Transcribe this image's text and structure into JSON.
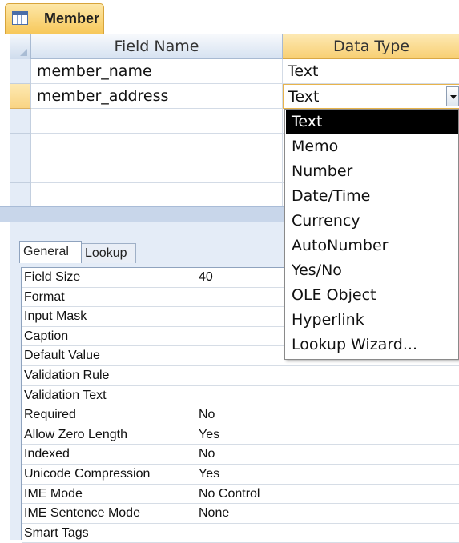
{
  "tab": {
    "title": "Member",
    "icon": "table-icon"
  },
  "grid": {
    "headers": {
      "field_name": "Field Name",
      "data_type": "Data Type"
    },
    "rows": [
      {
        "field": "member_name",
        "type": "Text"
      },
      {
        "field": "member_address",
        "type": "Text"
      }
    ]
  },
  "dropdown": {
    "selected": "Text",
    "options": [
      "Text",
      "Memo",
      "Number",
      "Date/Time",
      "Currency",
      "AutoNumber",
      "Yes/No",
      "OLE Object",
      "Hyperlink",
      "Lookup Wizard..."
    ]
  },
  "properties": {
    "tabs": {
      "general": "General",
      "lookup": "Lookup"
    },
    "rows": [
      {
        "name": "Field Size",
        "value": "40"
      },
      {
        "name": "Format",
        "value": ""
      },
      {
        "name": "Input Mask",
        "value": ""
      },
      {
        "name": "Caption",
        "value": ""
      },
      {
        "name": "Default Value",
        "value": ""
      },
      {
        "name": "Validation Rule",
        "value": ""
      },
      {
        "name": "Validation Text",
        "value": ""
      },
      {
        "name": "Required",
        "value": "No"
      },
      {
        "name": "Allow Zero Length",
        "value": "Yes"
      },
      {
        "name": "Indexed",
        "value": "No"
      },
      {
        "name": "Unicode Compression",
        "value": "Yes"
      },
      {
        "name": "IME Mode",
        "value": "No Control"
      },
      {
        "name": "IME Sentence Mode",
        "value": "None"
      },
      {
        "name": "Smart Tags",
        "value": ""
      }
    ]
  },
  "colors": {
    "tab_active": "#f8cf73",
    "grid_header": "#d6e2f1",
    "selection": "#000000"
  }
}
